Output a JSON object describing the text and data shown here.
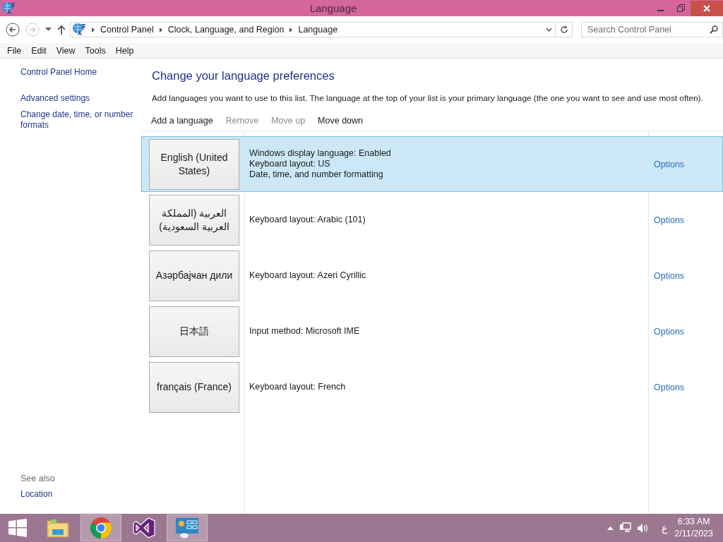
{
  "window": {
    "title": "Language"
  },
  "address": {
    "breadcrumbs": [
      "Control Panel",
      "Clock, Language, and Region",
      "Language"
    ]
  },
  "search": {
    "placeholder": "Search Control Panel"
  },
  "menu": [
    "File",
    "Edit",
    "View",
    "Tools",
    "Help"
  ],
  "sidebar": {
    "links": [
      "Control Panel Home",
      "Advanced settings",
      "Change date, time, or number formats"
    ],
    "see_also": "See also",
    "see_also_links": [
      "Location"
    ]
  },
  "heading": "Change your language preferences",
  "description": "Add languages you want to use to this list. The language at the top of your list is your primary language (the one you want to see and use most often).",
  "toolbar": [
    {
      "label": "Add a language",
      "disabled": false
    },
    {
      "label": "Remove",
      "disabled": true
    },
    {
      "label": "Move up",
      "disabled": true
    },
    {
      "label": "Move down",
      "disabled": false
    }
  ],
  "languages": [
    {
      "name": "English (United States)",
      "details": [
        "Windows display language: Enabled",
        "Keyboard layout: US",
        "Date, time, and number formatting"
      ],
      "action": "Options",
      "selected": true
    },
    {
      "name": "العربية (المملكة العربية السعودية)",
      "details": [
        "Keyboard layout: Arabic (101)"
      ],
      "action": "Options",
      "selected": false
    },
    {
      "name": "Азәрбајҹан дили",
      "details": [
        "Keyboard layout: Azeri Cyrillic"
      ],
      "action": "Options",
      "selected": false
    },
    {
      "name": "日本語",
      "details": [
        "Input method: Microsoft IME"
      ],
      "action": "Options",
      "selected": false
    },
    {
      "name": "français (France)",
      "details": [
        "Keyboard layout: French"
      ],
      "action": "Options",
      "selected": false
    }
  ],
  "taskbar": {
    "apps": [
      {
        "kind": "start",
        "selected": false
      },
      {
        "kind": "explorer",
        "selected": false
      },
      {
        "kind": "chrome",
        "selected": true
      },
      {
        "kind": "studio",
        "selected": false
      },
      {
        "kind": "control",
        "selected": true
      }
    ],
    "input_indicator": "ع",
    "time": "6:33 AM",
    "date": "2/11/2023"
  }
}
